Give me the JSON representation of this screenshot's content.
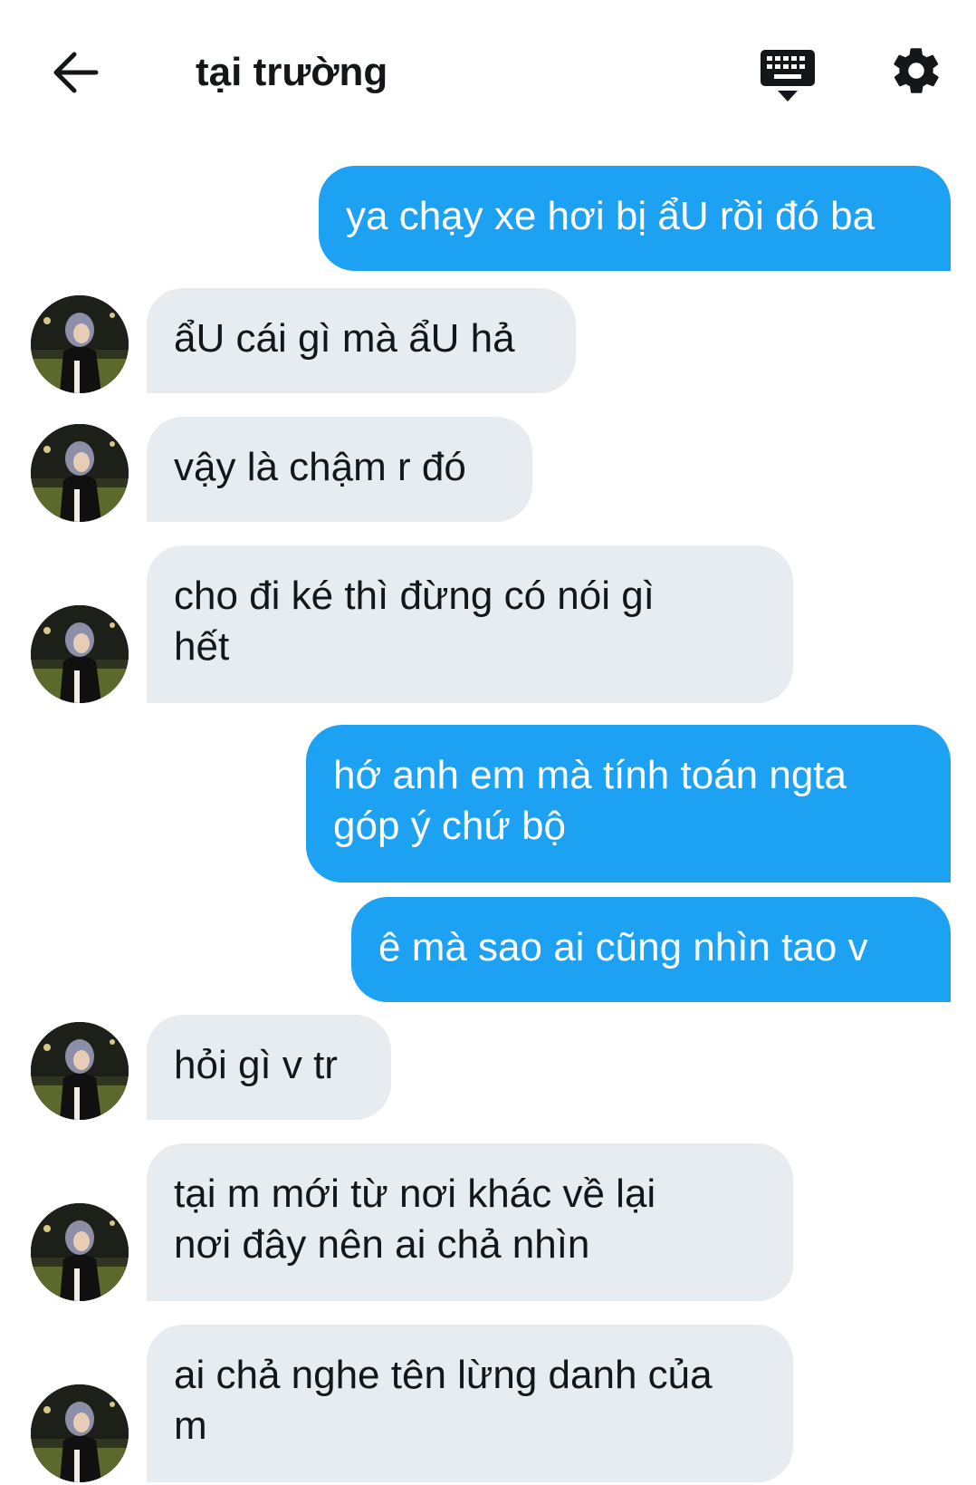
{
  "header": {
    "title": "tại trường",
    "icons": {
      "back": "arrow-left-icon",
      "keyboard": "keyboard-icon",
      "settings": "gear-icon"
    }
  },
  "colors": {
    "sent_bubble": "#1da1f2",
    "received_bubble": "#e6ecf0",
    "sent_text": "#ffffff",
    "received_text": "#14171a"
  },
  "messages": [
    {
      "direction": "sent",
      "text": "ya chạy xe hơi bị ẩU rồi đó ba"
    },
    {
      "direction": "received",
      "text": "ẩU cái gì mà ẩU hả"
    },
    {
      "direction": "received",
      "text": "vậy là chậm r đó"
    },
    {
      "direction": "received",
      "lines": [
        "cho đi ké thì đừng có nói gì",
        "hết"
      ]
    },
    {
      "direction": "sent",
      "lines": [
        "hớ anh em mà tính toán ngta",
        "góp ý chứ bộ"
      ]
    },
    {
      "direction": "sent",
      "text": "ê mà sao ai cũng nhìn tao v"
    },
    {
      "direction": "received",
      "text": "hỏi gì v tr"
    },
    {
      "direction": "received",
      "lines": [
        "tại m mới từ nơi khác về lại",
        "nơi đây nên ai chả nhìn"
      ]
    },
    {
      "direction": "received",
      "lines": [
        "ai chả nghe tên lừng danh của",
        "m"
      ]
    }
  ]
}
